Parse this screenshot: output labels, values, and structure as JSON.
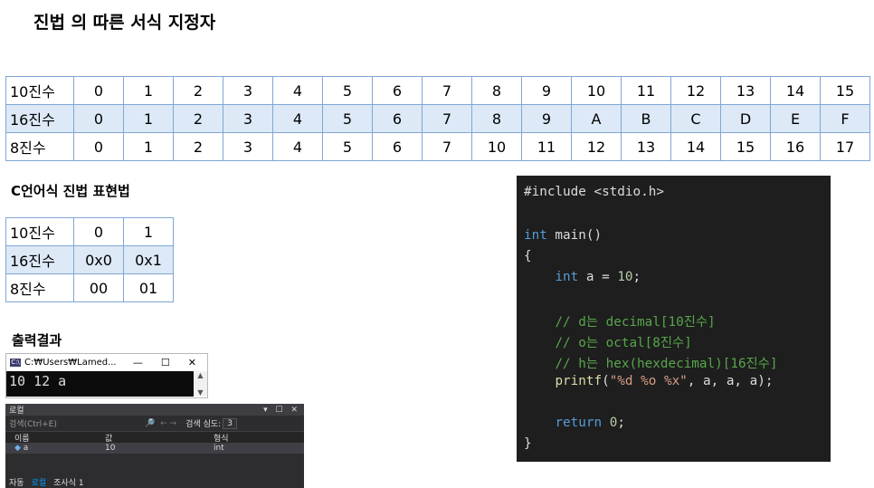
{
  "title": "진법 의 따른 서식 지정자",
  "base_table": {
    "rows": [
      {
        "label": "10진수",
        "values": [
          "0",
          "1",
          "2",
          "3",
          "4",
          "5",
          "6",
          "7",
          "8",
          "9",
          "10",
          "11",
          "12",
          "13",
          "14",
          "15"
        ]
      },
      {
        "label": "16진수",
        "values": [
          "0",
          "1",
          "2",
          "3",
          "4",
          "5",
          "6",
          "7",
          "8",
          "9",
          "A",
          "B",
          "C",
          "D",
          "E",
          "F"
        ]
      },
      {
        "label": "8진수",
        "values": [
          "0",
          "1",
          "2",
          "3",
          "4",
          "5",
          "6",
          "7",
          "10",
          "11",
          "12",
          "13",
          "14",
          "15",
          "16",
          "17"
        ]
      }
    ]
  },
  "c_title": "C언어식 진법 표현법",
  "c_table": {
    "rows": [
      {
        "label": "10진수",
        "values": [
          "0",
          "1"
        ]
      },
      {
        "label": "16진수",
        "values": [
          "0x0",
          "0x1"
        ]
      },
      {
        "label": "8진수",
        "values": [
          "00",
          "01"
        ]
      }
    ]
  },
  "output_title": "출력결과",
  "console": {
    "window_title": "C:₩Users₩Lamed...",
    "icon_label": "C:\\",
    "minimize": "—",
    "maximize": "☐",
    "close": "✕",
    "output": "10 12 a"
  },
  "locals": {
    "title": "로컬",
    "controls": "▾ ☐ ✕",
    "search_placeholder": "검색(Ctrl+E)",
    "search_icon": "🔎",
    "depth_label": "검색 심도:",
    "depth_value": "3",
    "columns": [
      "이름",
      "값",
      "형식"
    ],
    "row": {
      "name": "a",
      "value": "10",
      "type": "int"
    },
    "tabs": [
      "자동",
      "로컬",
      "조사식 1"
    ]
  },
  "code": {
    "include": "#include <stdio.h>",
    "main_kw": "int",
    "main_rest": " main()",
    "open_brace": "{",
    "decl_kw": "int",
    "decl_a": " a = ",
    "decl_num": "10",
    "decl_end": ";",
    "comment1": "// d는 decimal[10진수]",
    "comment2": "// o는 octal[8진수]",
    "comment3": "// h는 hex(hexdecimal)[16진수]",
    "printf_fn": "printf",
    "printf_open": "(",
    "printf_str": "\"%d %o %x\"",
    "printf_args": ", a, a, a);",
    "return_kw": "return",
    "return_val": " 0",
    "return_end": ";",
    "close_brace": "}"
  }
}
